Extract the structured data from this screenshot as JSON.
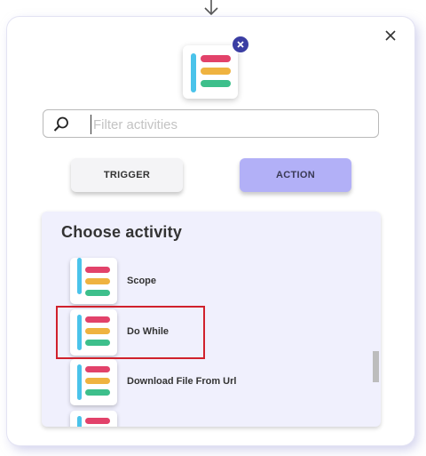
{
  "search": {
    "placeholder": "Filter activities",
    "value": ""
  },
  "tabs": {
    "trigger_label": "TRIGGER",
    "action_label": "ACTION",
    "selected": "ACTION"
  },
  "list": {
    "title": "Choose activity",
    "items": [
      {
        "label": "Scope"
      },
      {
        "label": "Do While",
        "highlighted": true
      },
      {
        "label": "Download File From Url"
      },
      {
        "label": ""
      }
    ]
  },
  "colors": {
    "accent": "#b2b0f7",
    "panel_bg": "#f0f0fd",
    "badge": "#3b3ea3",
    "highlight": "#d0212c",
    "logo_bars": [
      "#e2426a",
      "#efb340",
      "#3dbf8b"
    ],
    "logo_vertical": "#4ac3ea"
  },
  "icons": {
    "arrow": "arrow-down-icon",
    "close": "close-icon",
    "badge": "remove-badge-icon",
    "search": "search-icon",
    "activity": "activity-logo-icon"
  }
}
